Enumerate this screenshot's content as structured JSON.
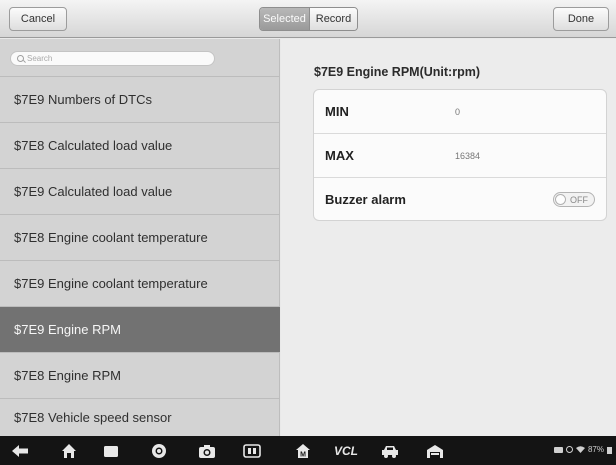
{
  "toolbar": {
    "cancel_label": "Cancel",
    "done_label": "Done",
    "segments": {
      "selected_label": "Selected",
      "record_label": "Record"
    }
  },
  "search": {
    "placeholder": "Search"
  },
  "list": {
    "items": [
      {
        "label": "$7E9 Numbers of DTCs"
      },
      {
        "label": "$7E8 Calculated load value"
      },
      {
        "label": "$7E9 Calculated load value"
      },
      {
        "label": "$7E8 Engine coolant temperature"
      },
      {
        "label": "$7E9 Engine coolant temperature"
      },
      {
        "label": "$7E9 Engine RPM",
        "selected": true
      },
      {
        "label": "$7E8 Engine RPM"
      },
      {
        "label": "$7E8 Vehicle speed sensor"
      }
    ]
  },
  "detail": {
    "title": "$7E9 Engine RPM(Unit:rpm)",
    "min_label": "MIN",
    "min_value": "0",
    "max_label": "MAX",
    "max_value": "16384",
    "buzzer_label": "Buzzer alarm",
    "buzzer_state": "OFF"
  },
  "navbar": {
    "icons": [
      "back-icon",
      "home-icon",
      "recent-apps-icon",
      "browser-icon",
      "camera-icon",
      "screenshot-icon",
      "maxisys-home-icon",
      "vcl-icon",
      "car-icon",
      "garage-icon"
    ],
    "vcl_label": "VCL",
    "status_text": "87%"
  },
  "colors": {
    "selected_row": "#727272",
    "list_background": "#d3d3d3",
    "navbar_background": "#141414"
  }
}
